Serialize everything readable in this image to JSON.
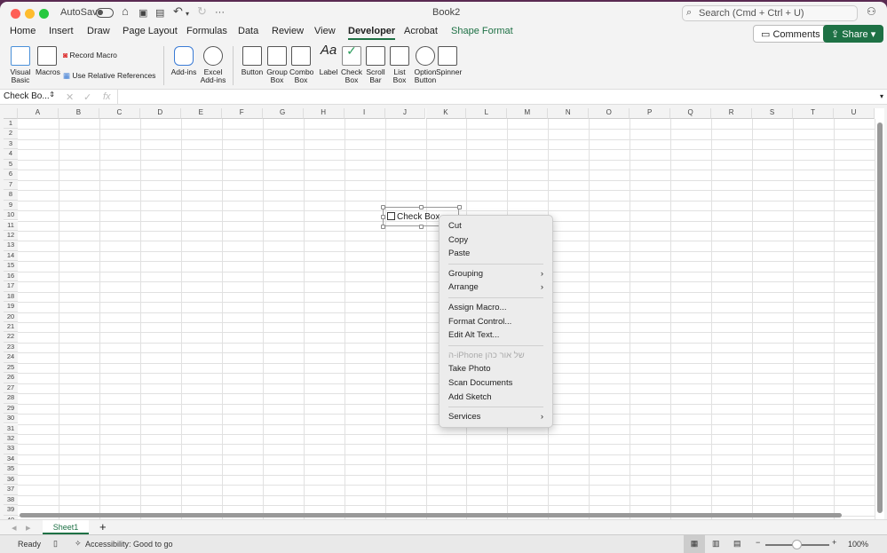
{
  "title_bar": {
    "autosave_label": "AutoSave",
    "doc_title": "Book2",
    "search_placeholder": "Search (Cmd + Ctrl + U)",
    "autosave_on": false
  },
  "tabs": [
    {
      "label": "Home"
    },
    {
      "label": "Insert"
    },
    {
      "label": "Draw"
    },
    {
      "label": "Page Layout"
    },
    {
      "label": "Formulas"
    },
    {
      "label": "Data"
    },
    {
      "label": "Review"
    },
    {
      "label": "View"
    },
    {
      "label": "Developer",
      "active": true
    },
    {
      "label": "Acrobat"
    },
    {
      "label": "Shape Format",
      "color": "#1e7145"
    }
  ],
  "header_buttons": {
    "comments": "Comments",
    "share": "Share"
  },
  "ribbon": {
    "visual_basic": "Visual Basic",
    "macros": "Macros",
    "record_macro": "Record Macro",
    "relative_refs": "Use Relative References",
    "add_ins": "Add-ins",
    "excel_add_ins": "Excel Add-ins",
    "controls": [
      "Button",
      "Group Box",
      "Combo Box",
      "Label",
      "Check Box",
      "Scroll Bar",
      "List Box",
      "Option Button",
      "Spinner"
    ]
  },
  "formula_bar": {
    "name_box": "Check Bo...",
    "fx": "fx",
    "value": ""
  },
  "columns": [
    "A",
    "B",
    "C",
    "D",
    "E",
    "F",
    "G",
    "H",
    "I",
    "J",
    "K",
    "L",
    "M",
    "N",
    "O",
    "P",
    "Q",
    "R",
    "S",
    "T",
    "U"
  ],
  "rows": [
    "1",
    "2",
    "3",
    "4",
    "5",
    "6",
    "7",
    "8",
    "9",
    "10",
    "11",
    "12",
    "13",
    "14",
    "15",
    "16",
    "17",
    "18",
    "19",
    "20",
    "21",
    "22",
    "23",
    "24",
    "25",
    "26",
    "27",
    "28",
    "29",
    "30",
    "31",
    "32",
    "33",
    "34",
    "35",
    "36",
    "37",
    "38",
    "39",
    "40"
  ],
  "checkbox": {
    "label": "Check Box",
    "checked": false
  },
  "context_menu": {
    "groups": [
      [
        {
          "label": "Cut"
        },
        {
          "label": "Copy"
        },
        {
          "label": "Paste"
        }
      ],
      [
        {
          "label": "Grouping",
          "submenu": true
        },
        {
          "label": "Arrange",
          "submenu": true
        }
      ],
      [
        {
          "label": "Assign Macro..."
        },
        {
          "label": "Format Control..."
        },
        {
          "label": "Edit Alt Text..."
        }
      ],
      [
        {
          "label": "ה-iPhone של אור כהן",
          "disabled": true
        },
        {
          "label": "Take Photo"
        },
        {
          "label": "Scan Documents"
        },
        {
          "label": "Add Sketch"
        }
      ],
      [
        {
          "label": "Services",
          "submenu": true
        }
      ]
    ]
  },
  "sheet_tabs": [
    {
      "label": "Sheet1",
      "active": true
    }
  ],
  "status": {
    "ready": "Ready",
    "accessibility": "Accessibility: Good to go",
    "zoom": "100%"
  },
  "colors": {
    "accent": "#1e7145"
  }
}
